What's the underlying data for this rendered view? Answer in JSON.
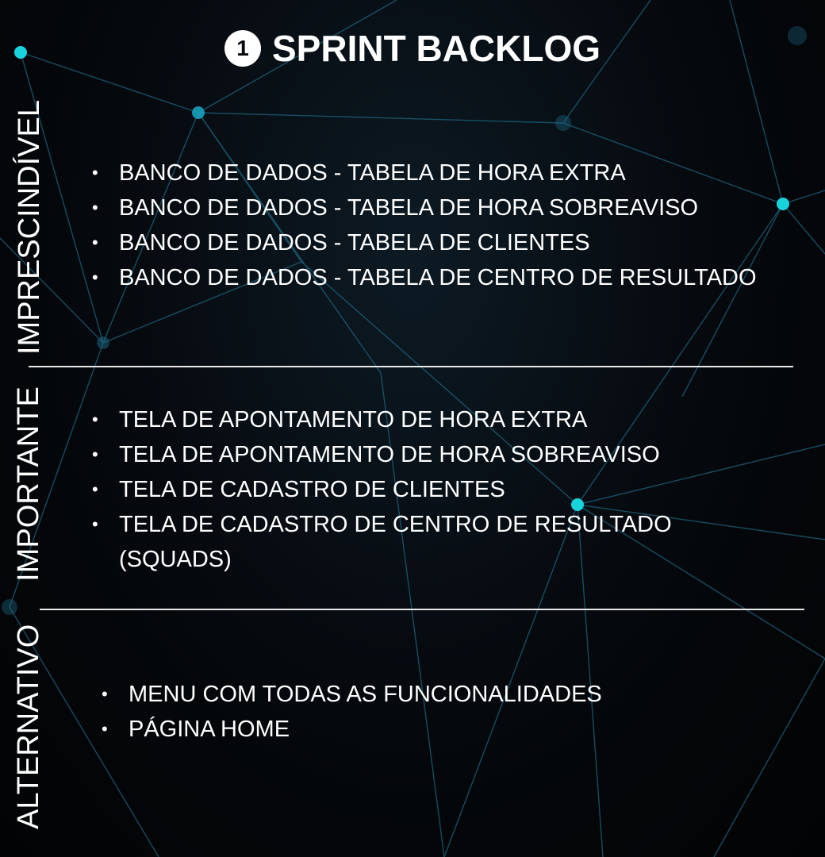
{
  "title": {
    "number": "1",
    "text": "SPRINT BACKLOG"
  },
  "sections": [
    {
      "label": "IMPRESCINDÍVEL",
      "items": [
        "BANCO DE DADOS - TABELA DE HORA EXTRA",
        "BANCO DE DADOS - TABELA DE HORA SOBREAVISO",
        "BANCO DE DADOS - TABELA DE CLIENTES",
        "BANCO DE DADOS - TABELA DE CENTRO DE RESULTADO"
      ]
    },
    {
      "label": "IMPORTANTE",
      "items": [
        "TELA DE APONTAMENTO DE HORA EXTRA",
        "TELA DE APONTAMENTO DE HORA SOBREAVISO",
        "TELA DE CADASTRO DE CLIENTES",
        "TELA DE  CADASTRO DE CENTRO DE RESULTADO (SQUADS)"
      ]
    },
    {
      "label": "ALTERNATIVO",
      "items": [
        "MENU COM TODAS AS FUNCIONALIDADES",
        "PÁGINA HOME"
      ]
    }
  ],
  "colors": {
    "background": "#05080c",
    "node_accent": "#19d3dc",
    "line": "#1e6a86",
    "text": "#ffffff",
    "divider": "#e8e8e8"
  }
}
